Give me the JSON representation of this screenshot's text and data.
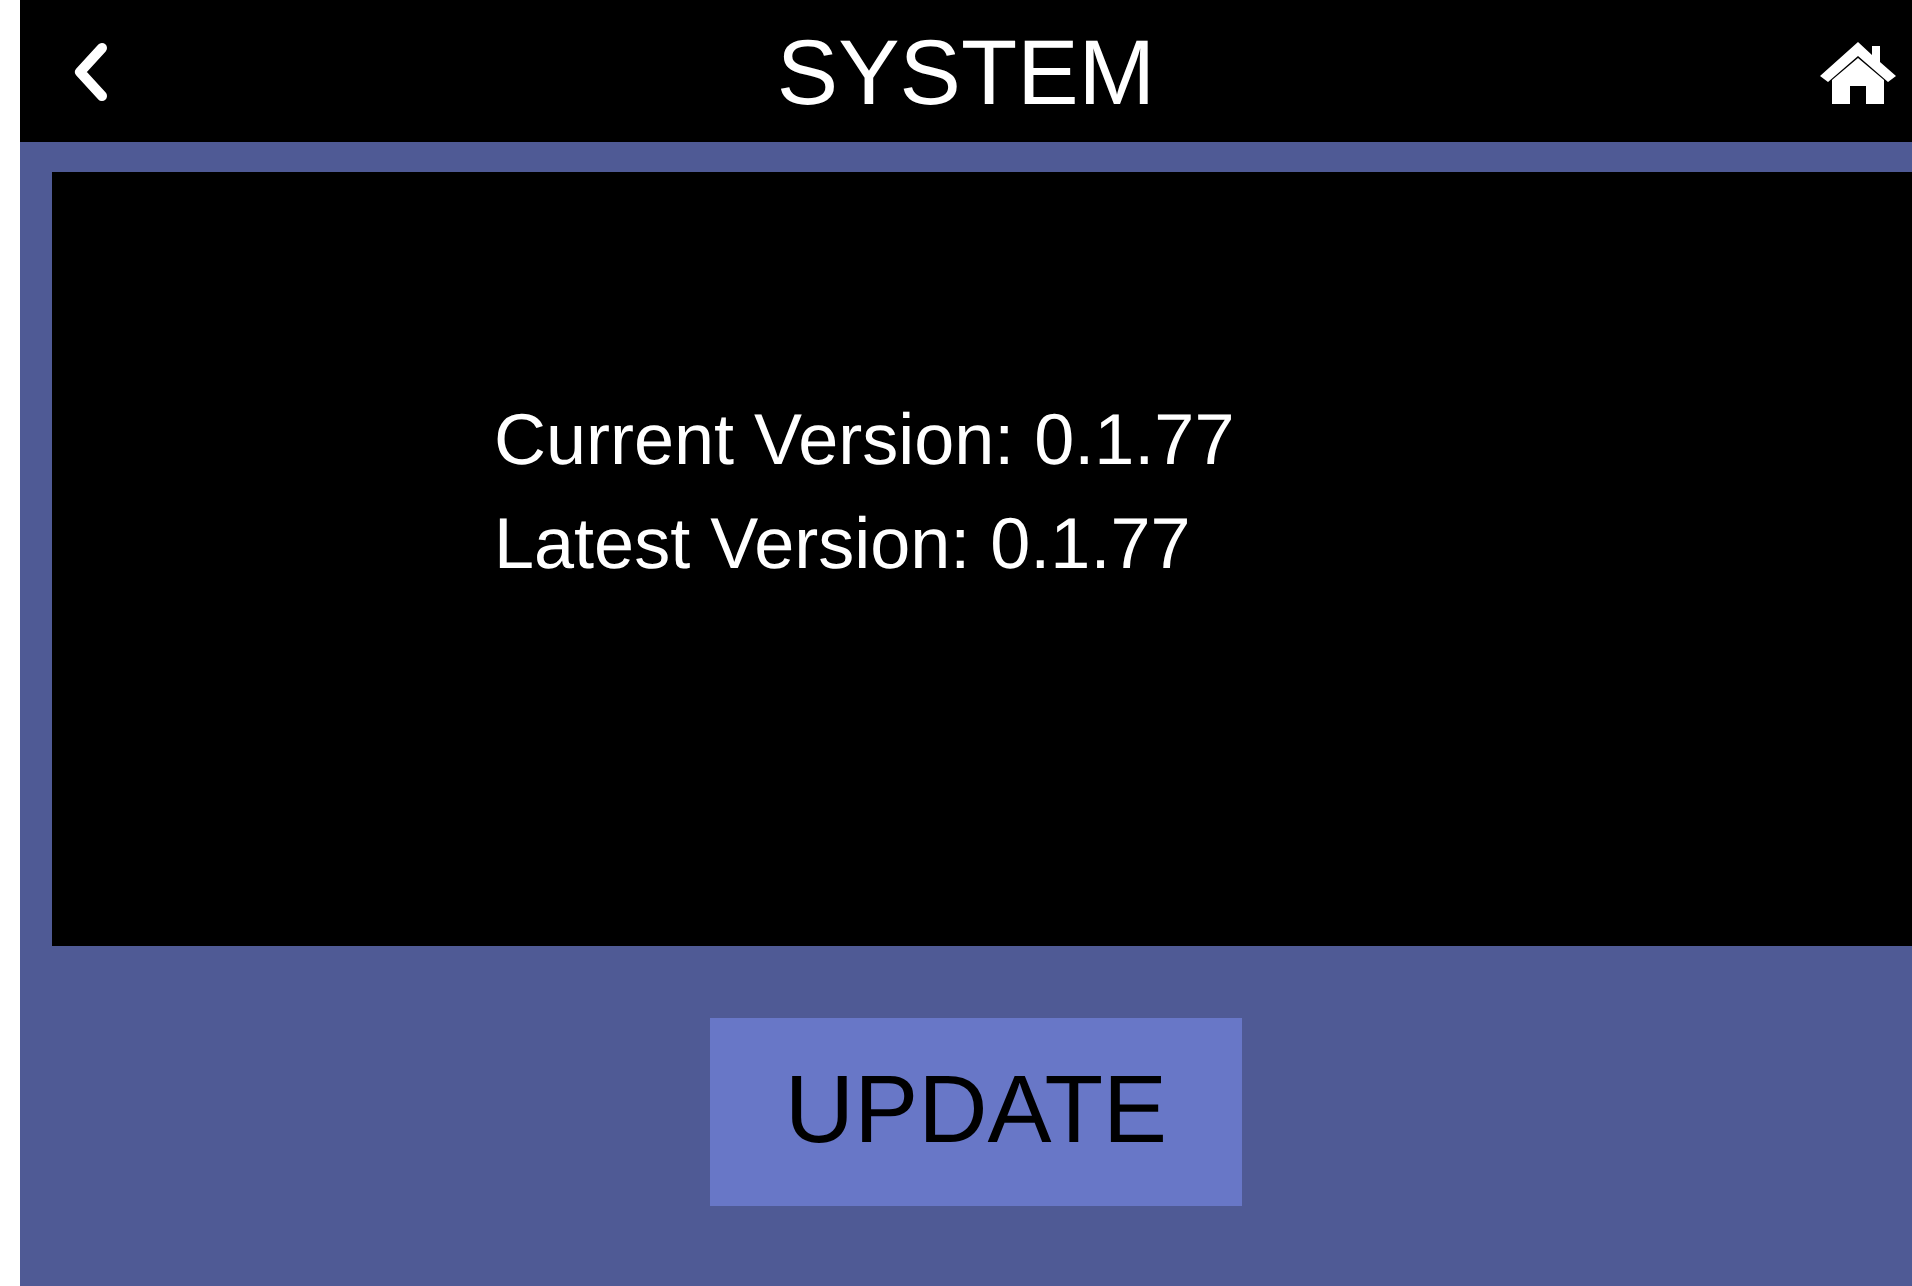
{
  "header": {
    "title": "SYSTEM"
  },
  "versions": [
    "Current Version: 0.1.77",
    "Latest Version: 0.1.77"
  ],
  "update_button": {
    "label": "UPDATE"
  }
}
